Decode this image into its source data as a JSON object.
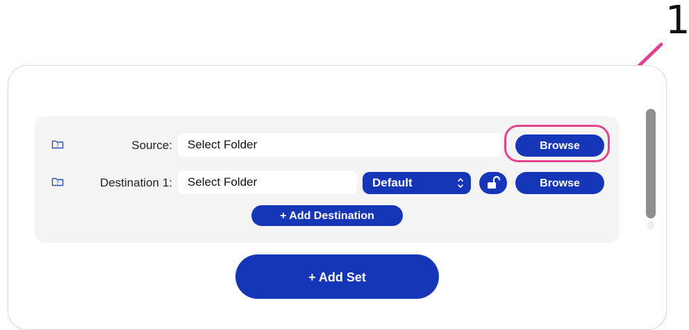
{
  "annotation": {
    "number": "1",
    "color": "#e2438f"
  },
  "set": {
    "source": {
      "label": "Source:",
      "field_value": "Select Folder",
      "browse_label": "Browse"
    },
    "destinations": [
      {
        "label": "Destination 1:",
        "field_value": "Select Folder",
        "mode_selected": "Default",
        "browse_label": "Browse",
        "lock_icon": "unlock-icon"
      }
    ],
    "add_destination_label": "+ Add Destination"
  },
  "add_set_label": "+ Add Set",
  "colors": {
    "accent": "#1636b8",
    "panel": "#f4f4f5",
    "highlight": "#e2438f"
  },
  "icons": {
    "row_icon": "folder-question-icon",
    "select_chevron": "chevron-up-down-icon"
  }
}
